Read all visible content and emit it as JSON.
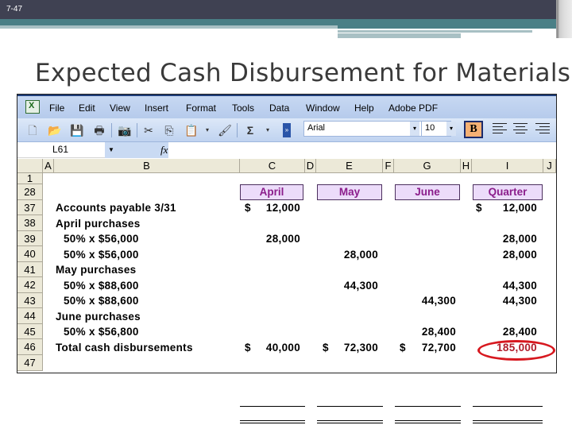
{
  "slide": {
    "number": "7-47",
    "title": "Expected Cash Disbursement for Materials"
  },
  "excel": {
    "menu": [
      "File",
      "Edit",
      "View",
      "Insert",
      "Format",
      "Tools",
      "Data",
      "Window",
      "Help",
      "Adobe PDF"
    ],
    "toolbar": {
      "icons": [
        "new-icon",
        "open-icon",
        "save-icon",
        "print-icon",
        "camera-icon",
        "cut-icon",
        "copy-icon",
        "paste-icon",
        "format-painter-icon",
        "autosum-icon"
      ],
      "autosum": "Σ",
      "font": "Arial",
      "font_size": "10",
      "bold": "B"
    },
    "name_box": "L61",
    "fx": "fx",
    "columns": [
      "A",
      "B",
      "C",
      "D",
      "E",
      "F",
      "G",
      "H",
      "I",
      "J"
    ],
    "headers": {
      "c": "April",
      "e": "May",
      "g": "June",
      "i": "Quarter"
    },
    "rows": [
      {
        "num": "1",
        "label": "",
        "c": "",
        "e": "",
        "g": "",
        "i": ""
      },
      {
        "num": "28",
        "label": "",
        "c": "",
        "e": "",
        "g": "",
        "i": ""
      },
      {
        "num": "37",
        "label": "Accounts payable 3/31",
        "c_sym": "$",
        "c": "12,000",
        "e": "",
        "g": "",
        "i_sym": "$",
        "i": "12,000"
      },
      {
        "num": "38",
        "label": "April purchases",
        "c": "",
        "e": "",
        "g": "",
        "i": ""
      },
      {
        "num": "39",
        "label": "  50% x $56,000",
        "c": "28,000",
        "e": "",
        "g": "",
        "i": "28,000"
      },
      {
        "num": "40",
        "label": "  50% x $56,000",
        "c": "",
        "e": "28,000",
        "g": "",
        "i": "28,000"
      },
      {
        "num": "41",
        "label": "May purchases",
        "c": "",
        "e": "",
        "g": "",
        "i": ""
      },
      {
        "num": "42",
        "label": "  50% x $88,600",
        "c": "",
        "e": "44,300",
        "g": "",
        "i": "44,300"
      },
      {
        "num": "43",
        "label": "  50% x $88,600",
        "c": "",
        "e": "",
        "g": "44,300",
        "i": "44,300"
      },
      {
        "num": "44",
        "label": "June purchases",
        "c": "",
        "e": "",
        "g": "",
        "i": ""
      },
      {
        "num": "45",
        "label": "  50% x $56,800",
        "c": "",
        "e": "",
        "g": "28,400",
        "i": "28,400"
      },
      {
        "num": "46",
        "label": "Total cash disbursements",
        "c_sym": "$",
        "c": "40,000",
        "e_sym": "$",
        "e": "72,300",
        "g_sym": "$",
        "g": "72,700",
        "i": "185,000"
      },
      {
        "num": "47",
        "label": "",
        "c": "",
        "e": "",
        "g": "",
        "i": ""
      }
    ],
    "highlight_color": "#d7181f"
  }
}
